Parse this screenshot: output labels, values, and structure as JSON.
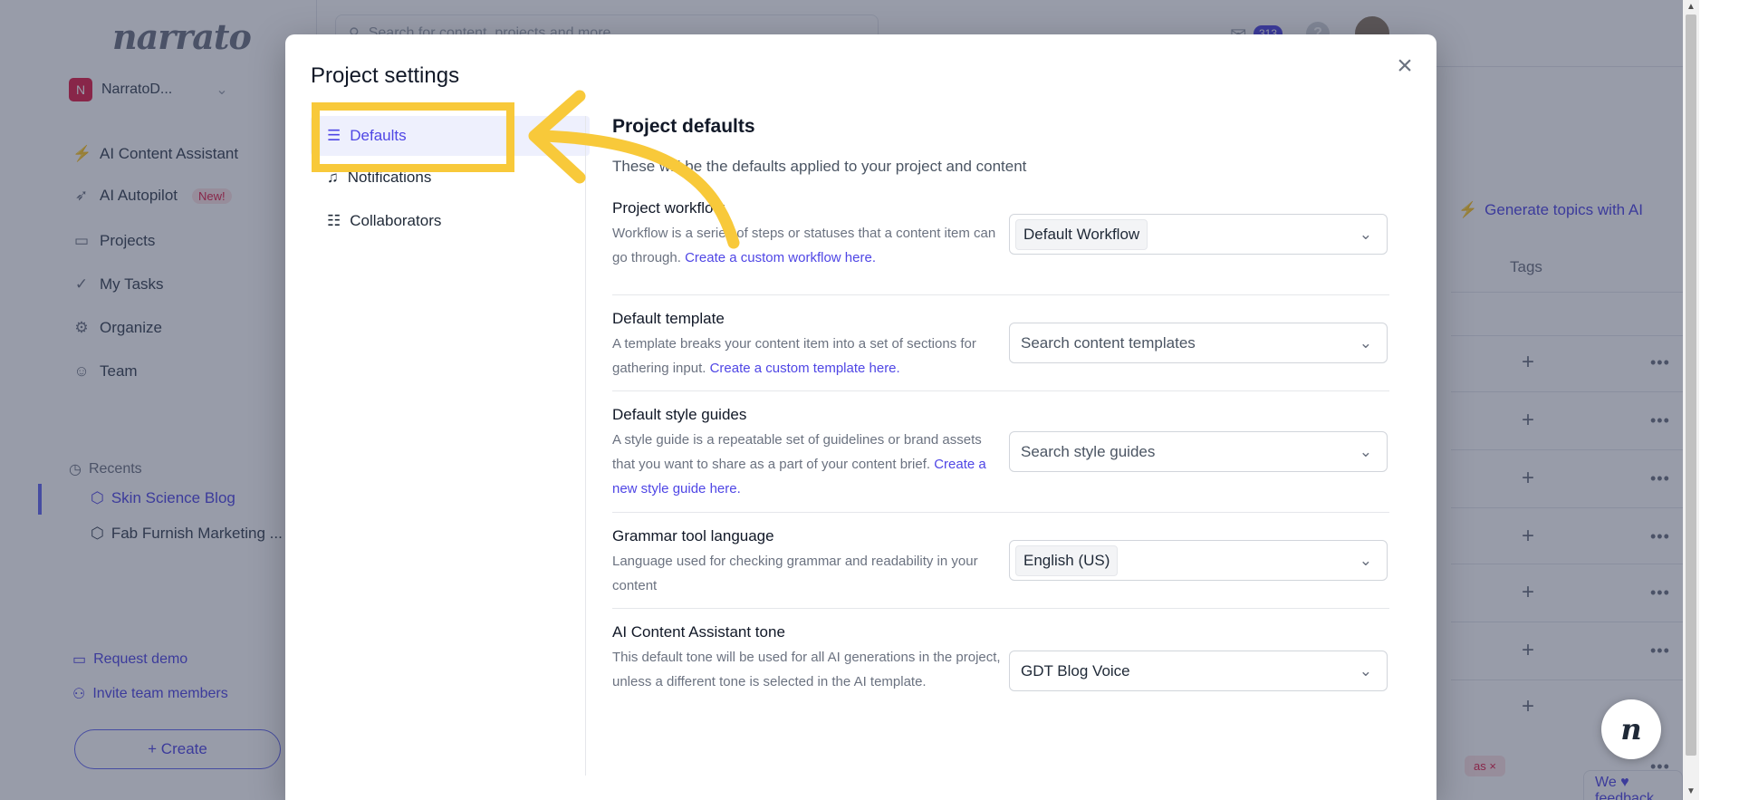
{
  "app": {
    "logo": "narrato",
    "workspace": {
      "badge": "N",
      "name": "NarratoD..."
    },
    "search_placeholder": "Search for content, projects and more",
    "mail_count": "313",
    "nav": [
      {
        "label": "AI Content Assistant",
        "icon": "bolt-icon"
      },
      {
        "label": "AI Autopilot",
        "badge": "New!",
        "icon": "rocket-icon"
      },
      {
        "label": "Projects",
        "icon": "briefcase-icon"
      },
      {
        "label": "My Tasks",
        "icon": "check-icon"
      },
      {
        "label": "Organize",
        "icon": "gears-icon"
      },
      {
        "label": "Team",
        "icon": "team-icon"
      }
    ],
    "recents_label": "Recents",
    "recents": [
      "Skin Science Blog",
      "Fab Furnish Marketing ..."
    ],
    "request_demo": "Request demo",
    "invite": "Invite team members",
    "create": "+ Create",
    "generate_topics": "Generate topics with AI",
    "tags_header": "Tags",
    "tag_chip": "as ×",
    "feedback": "We ♥ feedback",
    "fab": "n"
  },
  "modal": {
    "title": "Project settings",
    "close": "×",
    "nav": [
      {
        "label": "Defaults",
        "icon": "sliders-icon",
        "active": true
      },
      {
        "label": "Notifications",
        "icon": "bell-icon"
      },
      {
        "label": "Collaborators",
        "icon": "users-icon"
      }
    ],
    "heading": "Project defaults",
    "subheading": "These will be the defaults applied to your project and content",
    "settings": [
      {
        "label": "Project workflow",
        "desc": "Workflow is a series of steps or statuses that a content item can go through.",
        "link": "Create a custom workflow here.",
        "value": "Default Workflow",
        "style": "chip"
      },
      {
        "label": "Default template",
        "desc": "A template breaks your content item into a set of sections for gathering input.",
        "link": "Create a custom template here.",
        "value": "Search content templates",
        "style": "placeholder"
      },
      {
        "label": "Default style guides",
        "desc": "A style guide is a repeatable set of guidelines or brand assets that you want to share as a part of your content brief.",
        "link": "Create a new style guide here.",
        "value": "Search style guides",
        "style": "placeholder"
      },
      {
        "label": "Grammar tool language",
        "desc": "Language used for checking grammar and readability in your content",
        "link": "",
        "value": "English (US)",
        "style": "chip"
      },
      {
        "label": "AI Content Assistant tone",
        "desc": "This default tone will be used for all AI generations in the project, unless a different tone is selected in the AI template.",
        "link": "",
        "value": "GDT Blog Voice",
        "style": "plain"
      }
    ]
  },
  "colors": {
    "accent": "#4f46e5",
    "highlight": "#f8c93a",
    "overlay": "#28304c"
  }
}
